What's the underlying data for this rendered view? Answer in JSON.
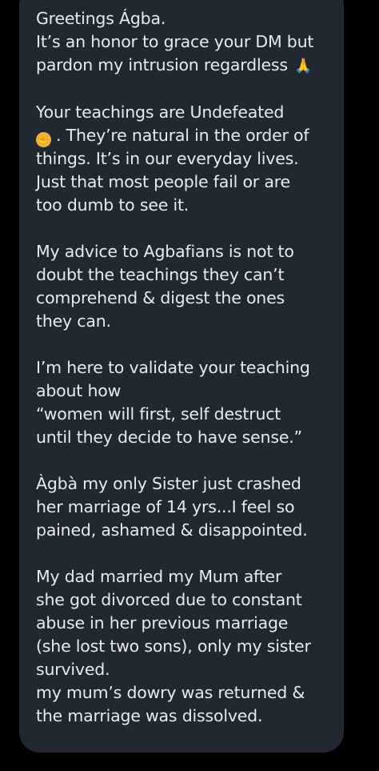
{
  "message": {
    "greeting": "Greetings Ágba.",
    "p1": [
      "It’s an honor to grace your DM but",
      "pardon my intrusion regardless"
    ],
    "p1_emoji": "pray",
    "p2_line1": "Your teachings are Undefeated",
    "p2_emoji": "fist",
    "p2_line2_after_emoji": ". They’re natural in the order of",
    "p2_rest": [
      "things. It’s in our everyday lives.",
      "Just that most people fail or are",
      "too dumb to see it."
    ],
    "p3": [
      "My advice to Agbafians is not to",
      "doubt the teachings they can’t",
      "comprehend & digest the ones",
      "they can."
    ],
    "p4": [
      "I’m here to validate your teaching",
      "about how",
      "“women will first, self destruct",
      "until they decide to have sense.”"
    ],
    "p5": [
      "Àgbà my only Sister just crashed",
      "her marriage of 14 yrs...I feel so",
      "pained, ashamed & disappointed."
    ],
    "p6": [
      "My dad married my Mum after",
      "she got divorced due to constant",
      "abuse in her previous marriage",
      "(she lost two sons), only my sister",
      "survived.",
      "my mum’s dowry was returned &",
      "the marriage was dissolved."
    ]
  },
  "colors": {
    "background": "#000000",
    "bubble": "#202932",
    "text": "#e8eaec"
  }
}
